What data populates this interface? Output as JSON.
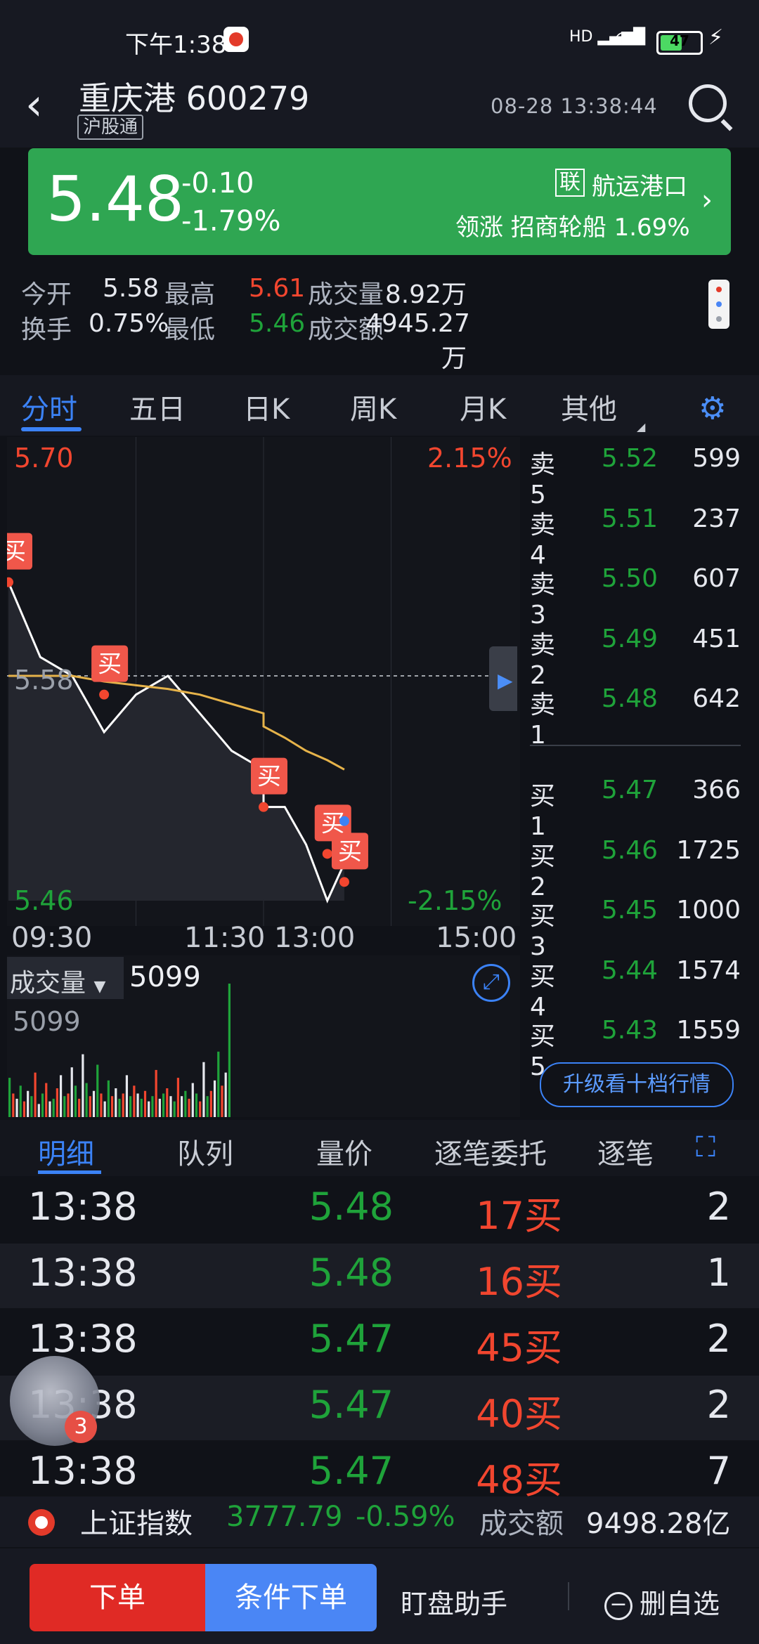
{
  "status_bar": {
    "time": "下午1:38",
    "signal": "HD",
    "battery": "47"
  },
  "header": {
    "title": "重庆港 600279",
    "tag": "沪股通",
    "datetime": "08-28 13:38:44"
  },
  "banner": {
    "price": "5.48",
    "change_abs": "-0.10",
    "change_pct": "-1.79%",
    "lian": "联",
    "sector": "航运港口",
    "leader": "领涨 招商轮船 1.69%"
  },
  "stats": {
    "open_label": "今开",
    "open": "5.58",
    "high_label": "最高",
    "high": "5.61",
    "volume_label": "成交量",
    "volume": "8.92万",
    "turnover_label": "换手",
    "turnover": "0.75%",
    "low_label": "最低",
    "low": "5.46",
    "amount_label": "成交额",
    "amount": "4945.27万"
  },
  "tabs": [
    "分时",
    "五日",
    "日K",
    "周K",
    "月K",
    "其他"
  ],
  "chart": {
    "y_top": "5.70",
    "y_top_pct": "2.15%",
    "y_mid": "5.58",
    "y_bot": "5.46",
    "y_bot_pct": "-2.15%",
    "time_labels": [
      "09:30",
      "11:30 13:00",
      "15:00"
    ],
    "buy_tag": "买",
    "volume_label": "成交量",
    "volume_value": "5099",
    "volume_axis_max": "5099"
  },
  "chart_data": {
    "type": "line",
    "title": "",
    "x": [
      "09:30",
      "09:45",
      "10:00",
      "10:15",
      "10:30",
      "10:45",
      "11:00",
      "11:15",
      "11:30",
      "13:00",
      "13:10",
      "13:20",
      "13:30",
      "13:38"
    ],
    "series": [
      {
        "values": [
          5.63,
          5.59,
          5.58,
          5.55,
          5.57,
          5.58,
          5.56,
          5.54,
          5.53,
          5.51,
          5.51,
          5.49,
          5.46,
          5.48
        ]
      },
      {
        "values": [
          5.58,
          5.58,
          5.58,
          5.577,
          5.575,
          5.573,
          5.57,
          5.565,
          5.56,
          5.553,
          5.547,
          5.54,
          5.535,
          5.53
        ]
      }
    ],
    "ylim": [
      5.46,
      5.7
    ],
    "buy_markers": [
      {
        "x": "09:30",
        "y": 5.63
      },
      {
        "x": "10:15",
        "y": 5.57
      },
      {
        "x": "13:00",
        "y": 5.51
      },
      {
        "x": "13:30",
        "y": 5.485
      },
      {
        "x": "13:38",
        "y": 5.47
      }
    ],
    "volume_bars": [
      1500,
      900,
      700,
      1200,
      600,
      1000,
      800,
      1700,
      500,
      900,
      1300,
      600,
      700,
      1100,
      1600,
      800,
      900,
      1900,
      1200,
      700,
      2400,
      1300,
      800,
      1000,
      2000,
      900,
      600,
      1400,
      800,
      1100,
      700,
      900,
      1600,
      800,
      1200,
      900,
      700,
      1000,
      600,
      800,
      1800,
      700,
      900,
      1100,
      800,
      600,
      1500,
      800,
      1000,
      700,
      1300,
      900,
      600,
      2100,
      800,
      1000,
      1400,
      2500,
      1200,
      1700,
      5099
    ]
  },
  "order_book": {
    "asks": [
      {
        "label": "卖5",
        "price": "5.52",
        "vol": "599"
      },
      {
        "label": "卖4",
        "price": "5.51",
        "vol": "237"
      },
      {
        "label": "卖3",
        "price": "5.50",
        "vol": "607"
      },
      {
        "label": "卖2",
        "price": "5.49",
        "vol": "451"
      },
      {
        "label": "卖1",
        "price": "5.48",
        "vol": "642"
      }
    ],
    "bids": [
      {
        "label": "买1",
        "price": "5.47",
        "vol": "366"
      },
      {
        "label": "买2",
        "price": "5.46",
        "vol": "1725"
      },
      {
        "label": "买3",
        "price": "5.45",
        "vol": "1000"
      },
      {
        "label": "买4",
        "price": "5.44",
        "vol": "1574"
      },
      {
        "label": "买5",
        "price": "5.43",
        "vol": "1559"
      }
    ],
    "upgrade": "升级看十档行情"
  },
  "detail_tabs": [
    "明细",
    "队列",
    "量价",
    "逐笔委托",
    "逐笔"
  ],
  "trades": [
    {
      "time": "13:38",
      "price": "5.48",
      "vol": "17买",
      "n": "2"
    },
    {
      "time": "13:38",
      "price": "5.48",
      "vol": "16买",
      "n": "1"
    },
    {
      "time": "13:38",
      "price": "5.47",
      "vol": "45买",
      "n": "2"
    },
    {
      "time": "13:38",
      "price": "5.47",
      "vol": "40买",
      "n": "2"
    },
    {
      "time": "13:38",
      "price": "5.47",
      "vol": "48买",
      "n": "7"
    }
  ],
  "avatar_badge": "3",
  "index_bar": {
    "name": "上证指数",
    "value": "3777.79",
    "change": "-0.59%",
    "amount_label": "成交额",
    "amount": "9498.28亿"
  },
  "bottom": {
    "order": "下单",
    "cond_order": "条件下单",
    "helper": "盯盘助手",
    "delete": "删自选"
  },
  "colors": {
    "up": "#f2462f",
    "down": "#1fa33a",
    "accent": "#3b82f6",
    "banner": "#2fa652"
  }
}
